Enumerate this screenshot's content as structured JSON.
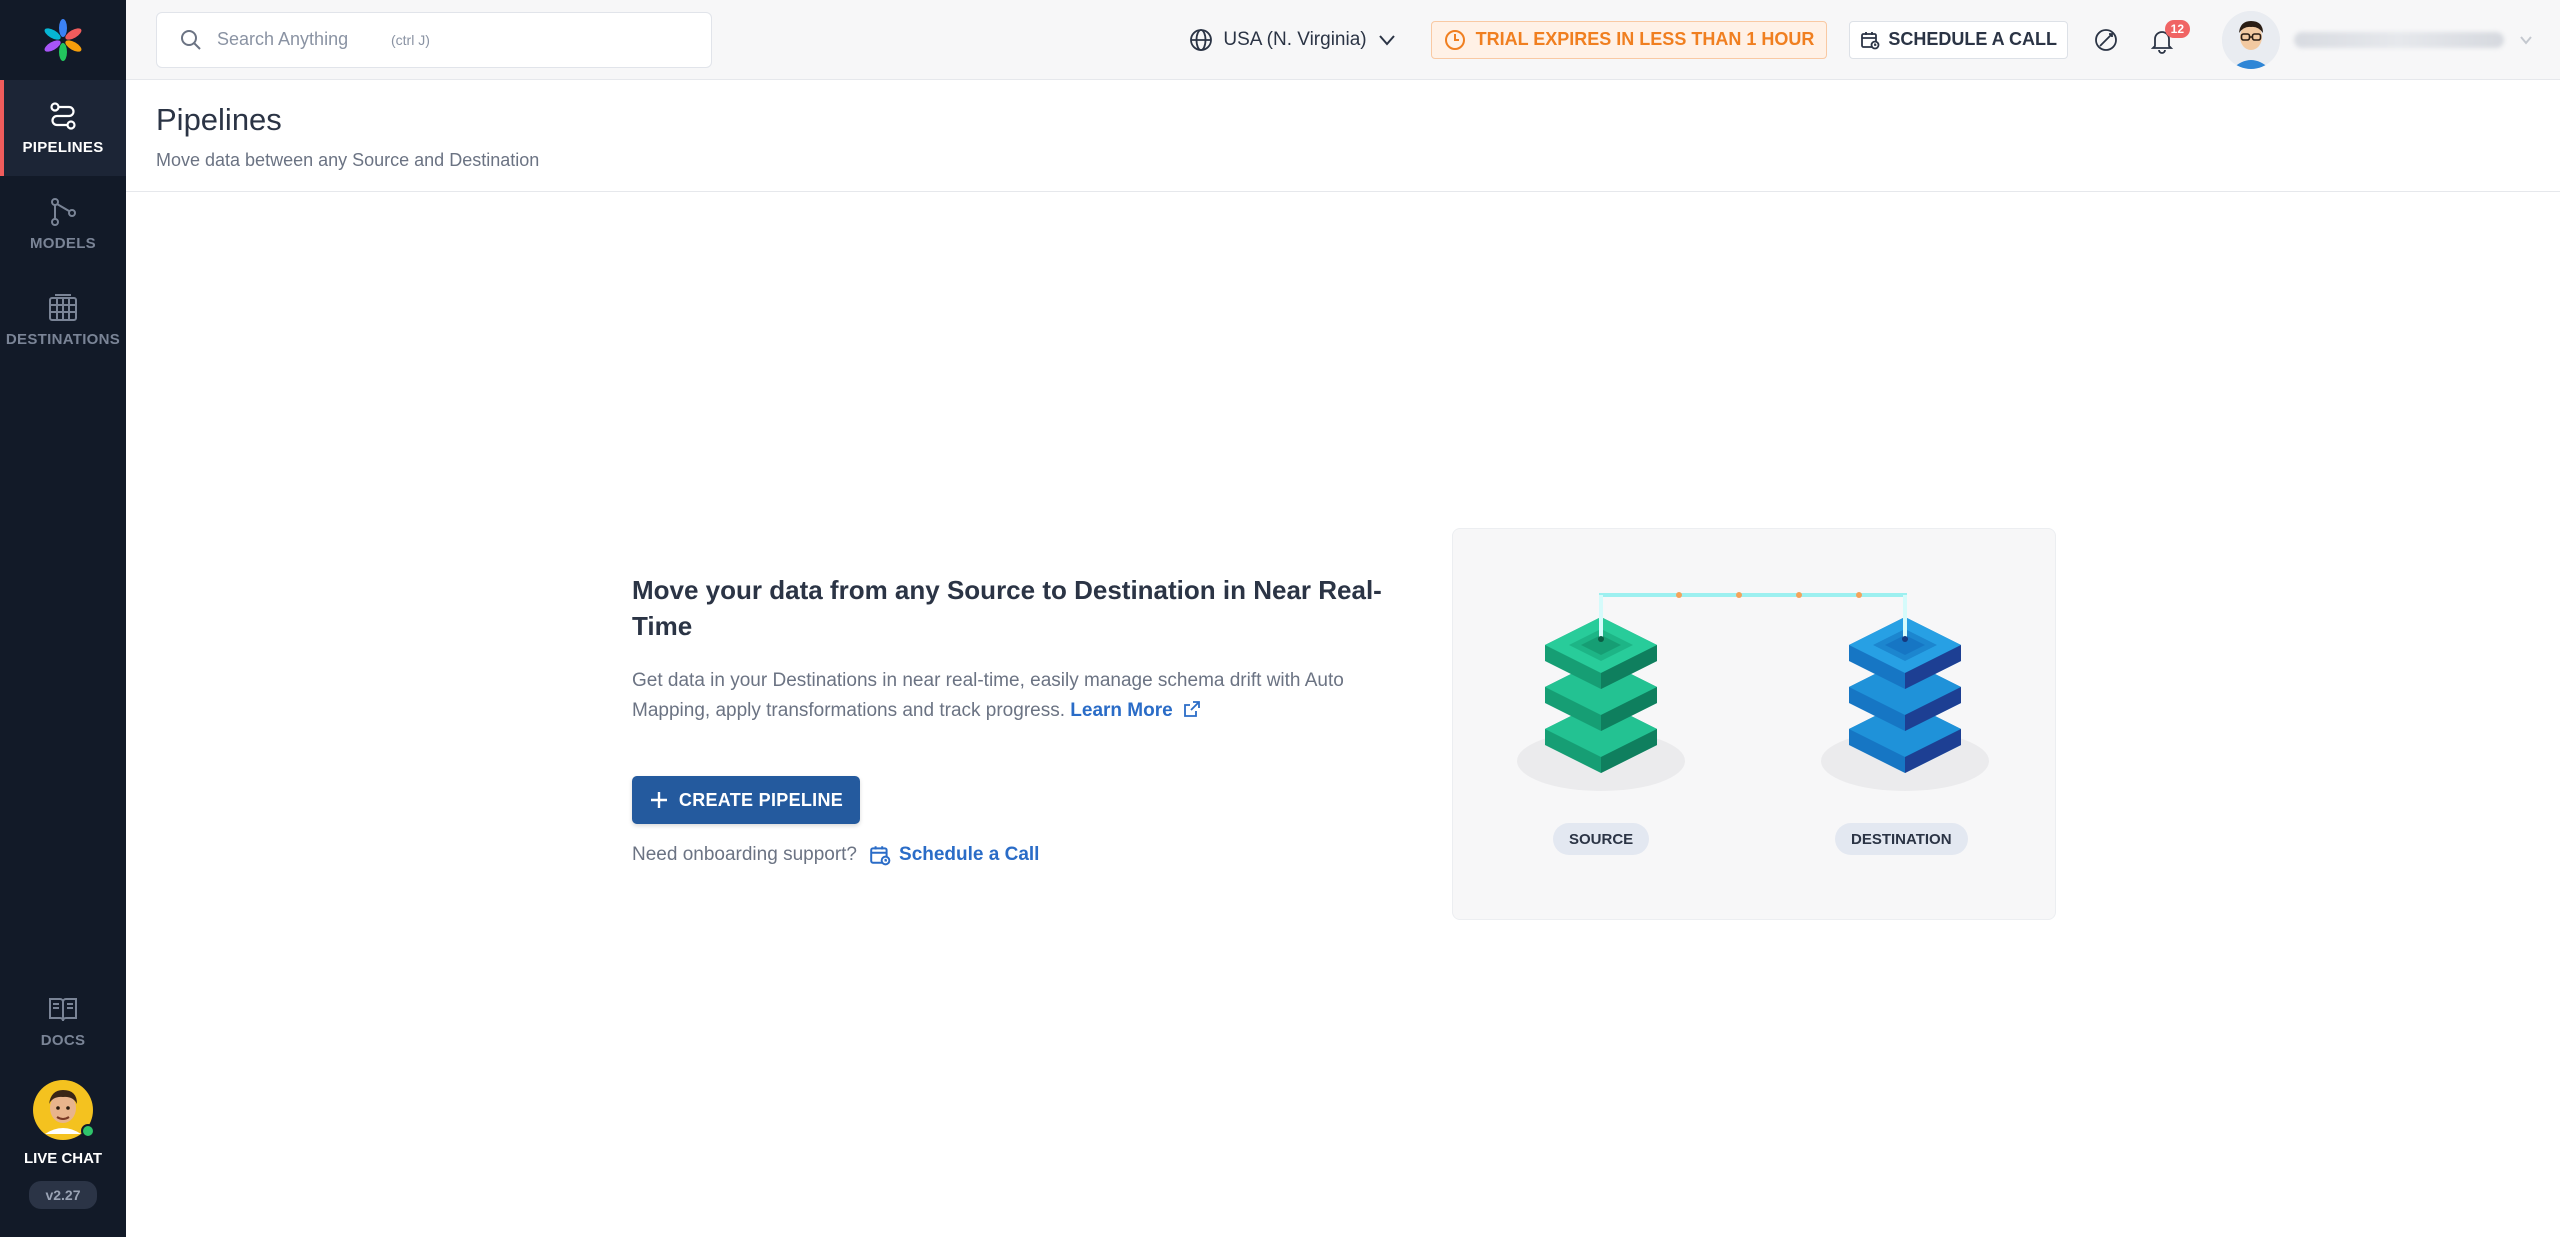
{
  "sidebar": {
    "items": [
      {
        "label": "PIPELINES"
      },
      {
        "label": "MODELS"
      },
      {
        "label": "DESTINATIONS"
      },
      {
        "label": "DOCS"
      }
    ],
    "chat_label": "LIVE CHAT",
    "version": "v2.27"
  },
  "topbar": {
    "search_placeholder": "Search Anything",
    "search_shortcut": "(ctrl J)",
    "region": "USA (N. Virginia)",
    "trial": "TRIAL EXPIRES IN LESS THAN 1 HOUR",
    "schedule": "SCHEDULE A CALL",
    "notifications": "12"
  },
  "header": {
    "title": "Pipelines",
    "subtitle": "Move data between any Source and Destination"
  },
  "empty_state": {
    "title": "Move your data from any Source to Destination in Near Real-Time",
    "description": "Get data in your Destinations in near real-time, easily manage schema drift with Auto Mapping, apply transformations and track progress.",
    "learn_more": "Learn More",
    "create_button": "CREATE PIPELINE",
    "onboarding_text": "Need onboarding support?",
    "schedule_link": "Schedule a Call",
    "source_tag": "SOURCE",
    "destination_tag": "DESTINATION"
  },
  "colors": {
    "sidebar_bg": "#121a28",
    "accent_active": "#f05c5c",
    "primary_button": "#245a9e",
    "link": "#2a6cc7",
    "trial": "#f07f20",
    "source_green": "#1fb888",
    "destination_blue": "#1a87d0"
  }
}
